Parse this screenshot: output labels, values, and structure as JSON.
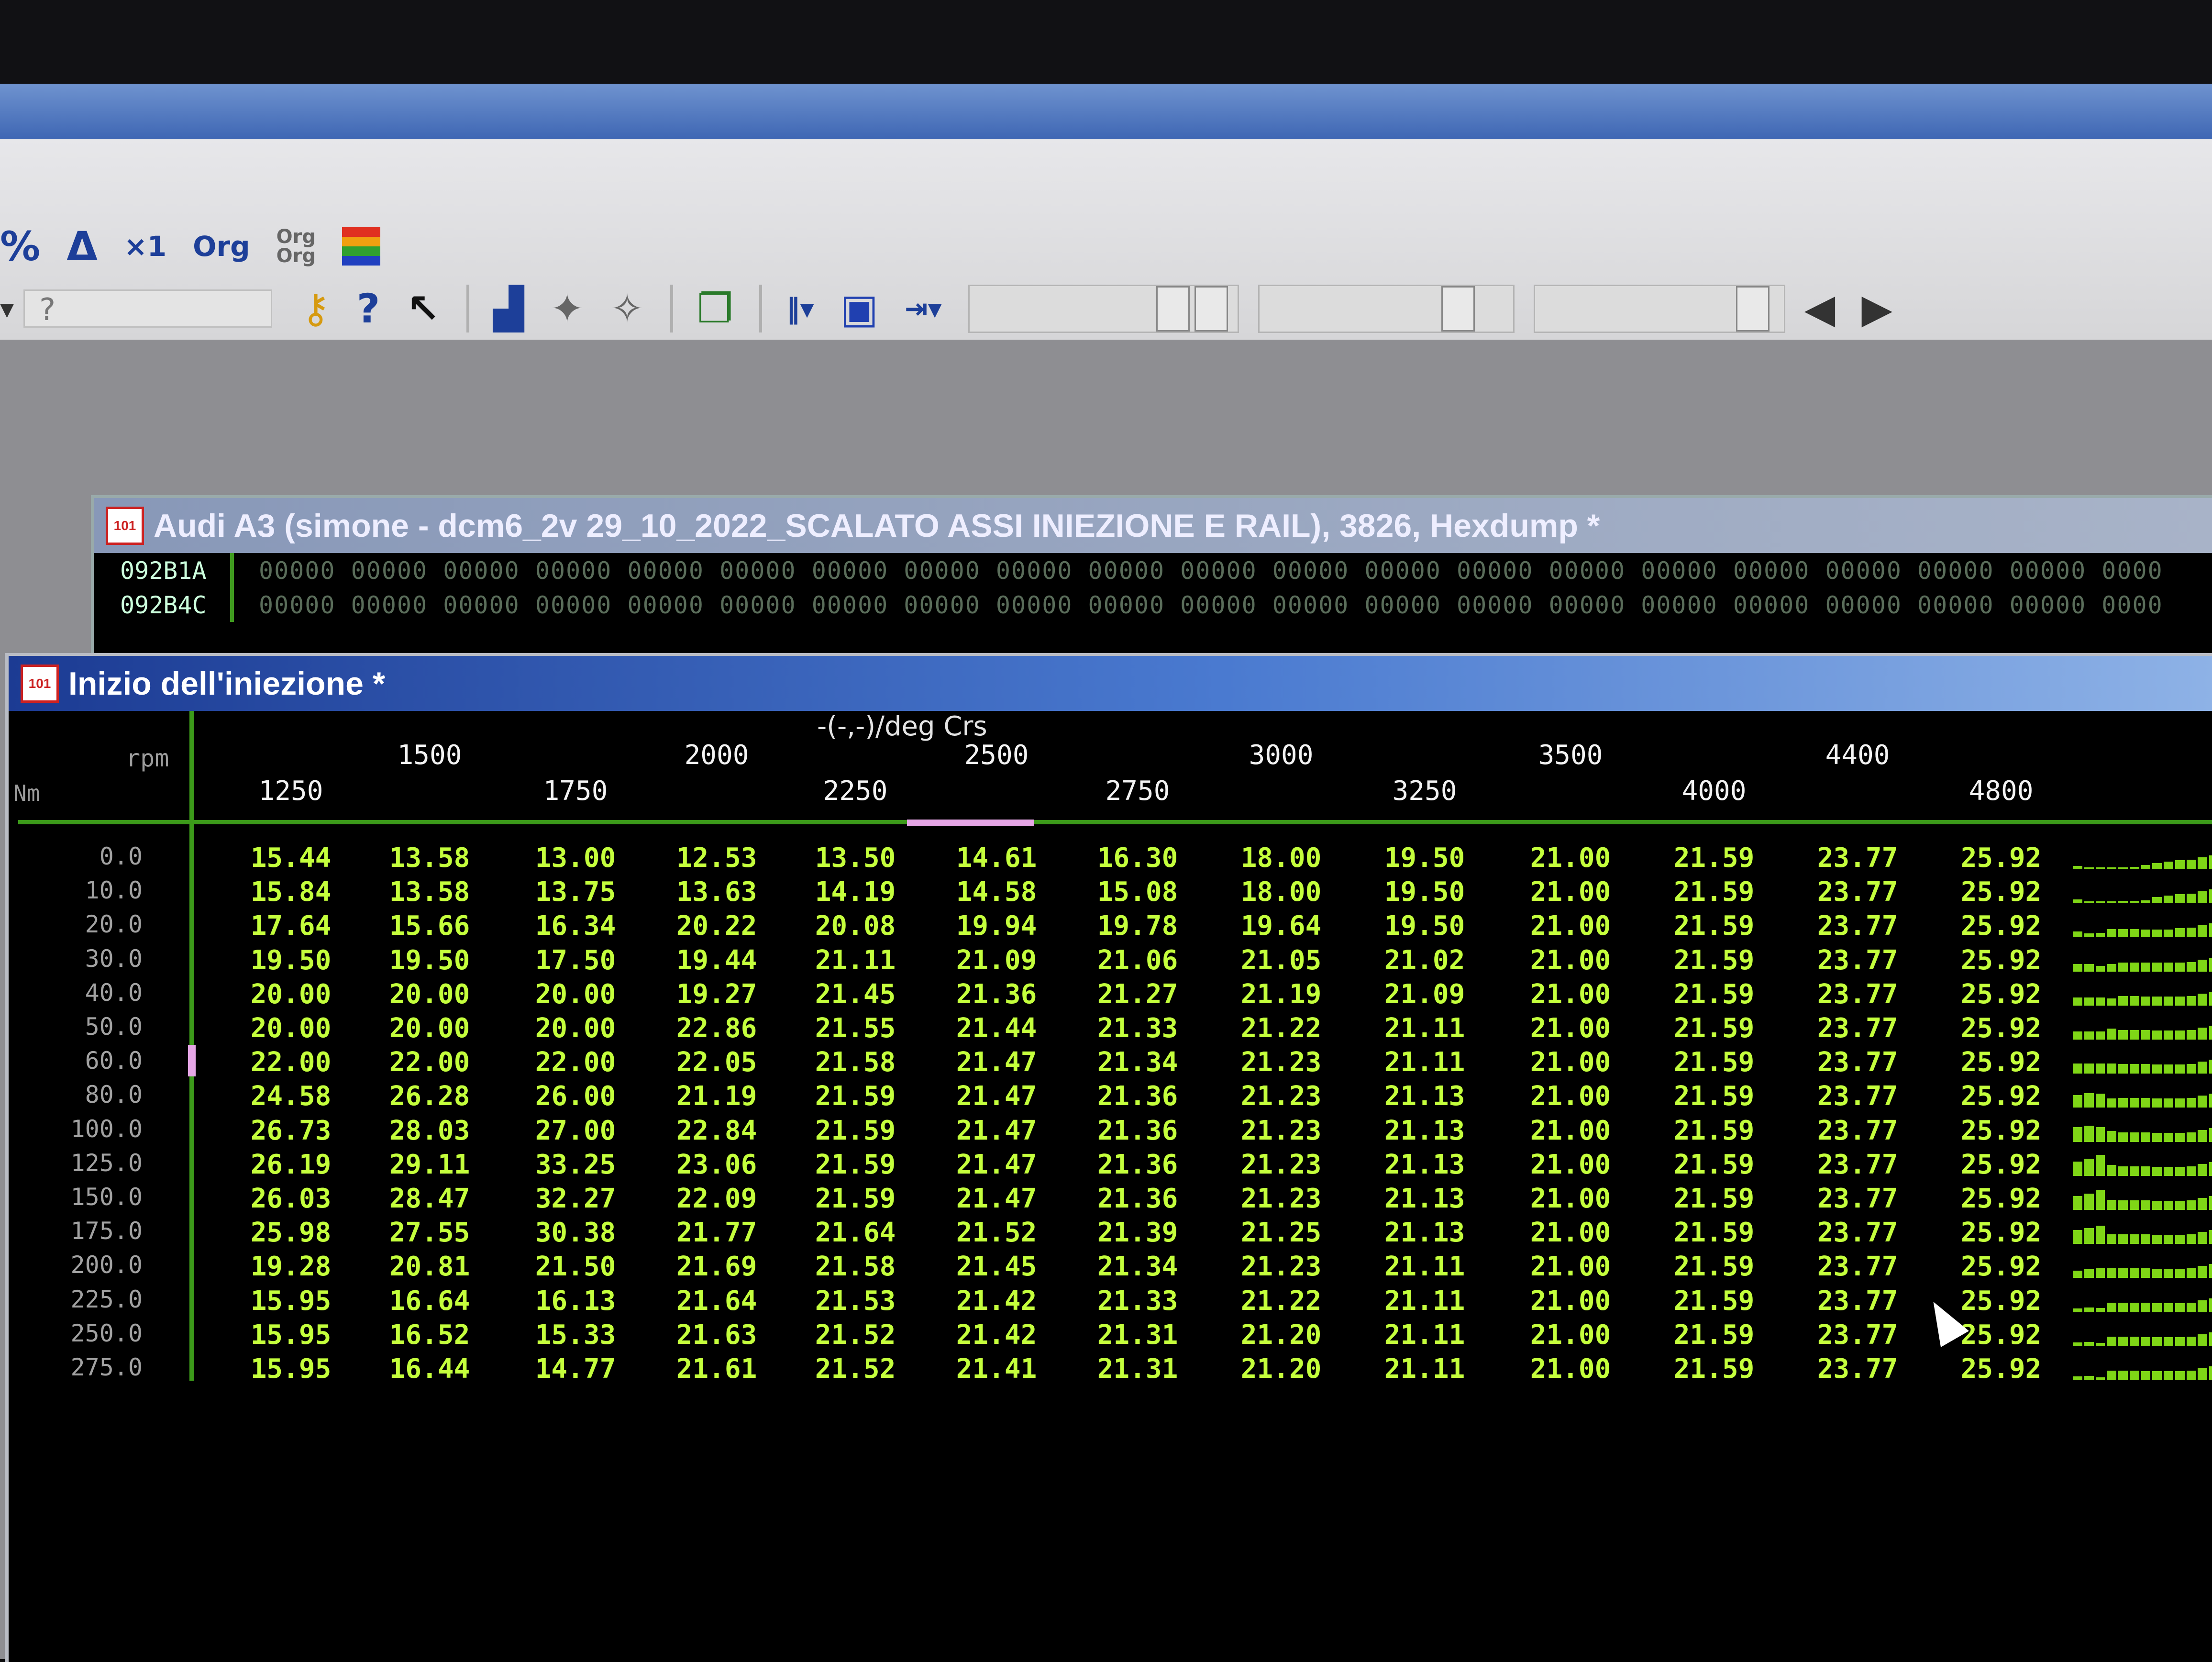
{
  "toolbar": {
    "row1": [
      "%",
      "Δ",
      "×1",
      "Org",
      "Org\nOrg"
    ],
    "help_placeholder": "?",
    "row2_icons": [
      "key-icon",
      "help-icon",
      "whats-this-icon",
      "chart-wizard-icon",
      "wand-icon",
      "wand2-icon",
      "copy-icon",
      "columns-icon",
      "window-icon",
      "insert-icon"
    ],
    "nav_prev": "◀",
    "nav_next": "▶"
  },
  "hexdump": {
    "title": "Audi A3 (simone - dcm6_2v 29_10_2022_SCALATO ASSI INIEZIONE E RAIL), 3826, Hexdump *",
    "rows": [
      {
        "addr": "092B1A",
        "values": "00000 00000 00000 00000 00000 00000 00000 00000 00000 00000 00000 00000 00000 00000 00000 00000 00000 00000 00000 00000 0000"
      },
      {
        "addr": "092B4C",
        "values": "00000 00000 00000 00000 00000 00000 00000 00000 00000 00000 00000 00000 00000 00000 00000 00000 00000 00000 00000 00000 0000"
      }
    ]
  },
  "map": {
    "title": "Inizio dell'iniezione *",
    "unit": "-(-,-)/deg Crs",
    "x_label": "rpm",
    "y_label": "Nm",
    "x_axis": [
      "1250",
      "1500",
      "1750",
      "2000",
      "2250",
      "2500",
      "2750",
      "3000",
      "3250",
      "3500",
      "4000",
      "4400",
      "4800"
    ],
    "y_axis": [
      "0.0",
      "10.0",
      "20.0",
      "30.0",
      "40.0",
      "50.0",
      "60.0",
      "80.0",
      "100.0",
      "125.0",
      "150.0",
      "175.0",
      "200.0",
      "225.0",
      "250.0",
      "275.0"
    ],
    "rows": [
      [
        "15.44",
        "13.58",
        "13.00",
        "12.53",
        "13.50",
        "14.61",
        "16.30",
        "18.00",
        "19.50",
        "21.00",
        "21.59",
        "23.77",
        "25.92"
      ],
      [
        "15.84",
        "13.58",
        "13.75",
        "13.63",
        "14.19",
        "14.58",
        "15.08",
        "18.00",
        "19.50",
        "21.00",
        "21.59",
        "23.77",
        "25.92"
      ],
      [
        "17.64",
        "15.66",
        "16.34",
        "20.22",
        "20.08",
        "19.94",
        "19.78",
        "19.64",
        "19.50",
        "21.00",
        "21.59",
        "23.77",
        "25.92"
      ],
      [
        "19.50",
        "19.50",
        "17.50",
        "19.44",
        "21.11",
        "21.09",
        "21.06",
        "21.05",
        "21.02",
        "21.00",
        "21.59",
        "23.77",
        "25.92"
      ],
      [
        "20.00",
        "20.00",
        "20.00",
        "19.27",
        "21.45",
        "21.36",
        "21.27",
        "21.19",
        "21.09",
        "21.00",
        "21.59",
        "23.77",
        "25.92"
      ],
      [
        "20.00",
        "20.00",
        "20.00",
        "22.86",
        "21.55",
        "21.44",
        "21.33",
        "21.22",
        "21.11",
        "21.00",
        "21.59",
        "23.77",
        "25.92"
      ],
      [
        "22.00",
        "22.00",
        "22.00",
        "22.05",
        "21.58",
        "21.47",
        "21.34",
        "21.23",
        "21.11",
        "21.00",
        "21.59",
        "23.77",
        "25.92"
      ],
      [
        "24.58",
        "26.28",
        "26.00",
        "21.19",
        "21.59",
        "21.47",
        "21.36",
        "21.23",
        "21.13",
        "21.00",
        "21.59",
        "23.77",
        "25.92"
      ],
      [
        "26.73",
        "28.03",
        "27.00",
        "22.84",
        "21.59",
        "21.47",
        "21.36",
        "21.23",
        "21.13",
        "21.00",
        "21.59",
        "23.77",
        "25.92"
      ],
      [
        "26.19",
        "29.11",
        "33.25",
        "23.06",
        "21.59",
        "21.47",
        "21.36",
        "21.23",
        "21.13",
        "21.00",
        "21.59",
        "23.77",
        "25.92"
      ],
      [
        "26.03",
        "28.47",
        "32.27",
        "22.09",
        "21.59",
        "21.47",
        "21.36",
        "21.23",
        "21.13",
        "21.00",
        "21.59",
        "23.77",
        "25.92"
      ],
      [
        "25.98",
        "27.55",
        "30.38",
        "21.77",
        "21.64",
        "21.52",
        "21.39",
        "21.25",
        "21.13",
        "21.00",
        "21.59",
        "23.77",
        "25.92"
      ],
      [
        "19.28",
        "20.81",
        "21.50",
        "21.69",
        "21.58",
        "21.45",
        "21.34",
        "21.23",
        "21.11",
        "21.00",
        "21.59",
        "23.77",
        "25.92"
      ],
      [
        "15.95",
        "16.64",
        "16.13",
        "21.64",
        "21.53",
        "21.42",
        "21.33",
        "21.22",
        "21.11",
        "21.00",
        "21.59",
        "23.77",
        "25.92"
      ],
      [
        "15.95",
        "16.52",
        "15.33",
        "21.63",
        "21.52",
        "21.42",
        "21.31",
        "21.20",
        "21.11",
        "21.00",
        "21.59",
        "23.77",
        "25.92"
      ],
      [
        "15.95",
        "16.44",
        "14.77",
        "21.61",
        "21.52",
        "21.41",
        "21.31",
        "21.20",
        "21.11",
        "21.00",
        "21.59",
        "23.77",
        "25.92"
      ]
    ],
    "colors": {
      "value": "#c4ff3c",
      "grid": "#3c9a1a",
      "selection": "#e6a6e6"
    }
  }
}
